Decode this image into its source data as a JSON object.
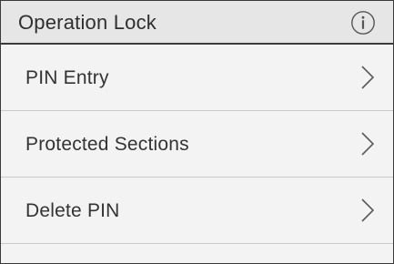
{
  "header": {
    "title": "Operation Lock",
    "info_icon": "info-icon"
  },
  "menu": {
    "items": [
      {
        "label": "PIN Entry",
        "icon": "chevron-right-icon"
      },
      {
        "label": "Protected Sections",
        "icon": "chevron-right-icon"
      },
      {
        "label": "Delete PIN",
        "icon": "chevron-right-icon"
      }
    ]
  },
  "colors": {
    "background": "#f3f3f3",
    "header_background": "#e6e6e6",
    "text": "#333333",
    "divider": "#c9c9c9",
    "header_divider": "#3b3b3b"
  }
}
